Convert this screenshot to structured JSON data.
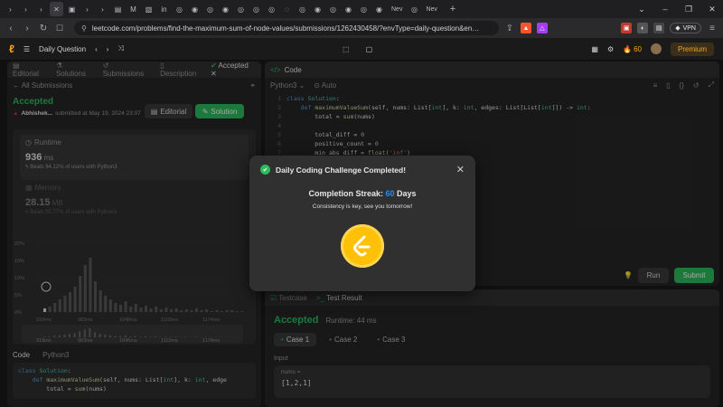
{
  "browser": {
    "tabs": [
      "›",
      "›",
      "›",
      "✕",
      "▣",
      "›",
      "›",
      "▤",
      "M",
      "▧",
      "in",
      "◎",
      "◉",
      "◎",
      "◉",
      "◎",
      "◎",
      "◎",
      "◌",
      "◎",
      "◉",
      "◎",
      "◉",
      "◎",
      "◉"
    ],
    "tab_label_1": "Nev",
    "tab_label_2": "Nev",
    "url": "leetcode.com/problems/find-the-maximum-sum-of-node-values/submissions/1262430458/?envType=daily-question&en…",
    "vpn_label": "VPN"
  },
  "header": {
    "title": "Daily Question",
    "streak_count": "60",
    "premium_label": "Premium"
  },
  "left": {
    "tabs": [
      "Editorial",
      "Solutions",
      "Submissions",
      "Description",
      "Accepted"
    ],
    "back_label": "All Submissions",
    "status": "Accepted",
    "user": "Abhishek...",
    "submitted": "submitted at May 19, 2024 23:07",
    "editorial_btn": "Editorial",
    "solution_btn": "Solution",
    "runtime_label": "Runtime",
    "runtime_value": "936",
    "runtime_unit": "ms",
    "runtime_beats": "Beats 94.12% of users with Python3",
    "memory_label": "Memory",
    "memory_value": "28.15",
    "memory_unit": "MB",
    "memory_beats": "Beats 55.77% of users with Python3",
    "y_ticks": [
      "20%",
      "15%",
      "10%",
      "5%",
      "0%"
    ],
    "x_ticks": [
      "919ms",
      "983ms",
      "1048ms",
      "1103ms",
      "1174ms"
    ],
    "mini_ticks": [
      "919ms",
      "983ms",
      "1046ms",
      "1110ms",
      "1174ms"
    ],
    "code_tab": "Code",
    "lang": "Python3",
    "code_lines": [
      "class Solution:",
      "    def maximumValueSum(self, nums: List[int], k: int, edge",
      "        total = sum(nums)"
    ]
  },
  "editor": {
    "tab": "Code",
    "lang": "Python3",
    "mode": "Auto",
    "line_numbers": [
      "1",
      "2",
      "3",
      "4",
      "5",
      "6",
      "7"
    ],
    "lines": [
      "class Solution:",
      "    def maximumValueSum(self, nums: List[int], k: int, edges: List[List[int]]) -> int:",
      "        total = sum(nums)",
      "",
      "        total_diff = 0",
      "        positive_count = 0",
      "        min_abs_diff = float('inf')"
    ],
    "run_label": "Run",
    "submit_label": "Submit"
  },
  "result": {
    "tab1": "Testcase",
    "tab2": "Test Result",
    "status": "Accepted",
    "runtime": "Runtime: 44 ms",
    "cases": [
      "Case 1",
      "Case 2",
      "Case 3"
    ],
    "input_label": "Input",
    "var_label": "nums =",
    "var_value": "[1,2,1]"
  },
  "modal": {
    "title": "Daily Coding Challenge Completed!",
    "streak_prefix": "Completion Streak:",
    "streak_value": "60",
    "streak_suffix": "Days",
    "message": "Consistency is key, see you tomorrow!"
  },
  "colors": {
    "accent_green": "#2cbb5d",
    "leetcode_orange": "#ffa116",
    "streak_blue": "#1e90ff",
    "coin_yellow": "#ffc107"
  }
}
